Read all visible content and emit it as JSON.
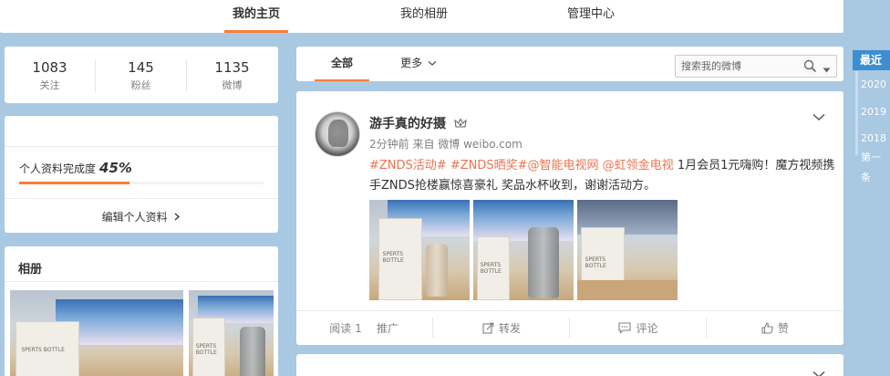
{
  "topnav": {
    "tabs": [
      "我的主页",
      "我的相册",
      "管理中心"
    ]
  },
  "stats": [
    {
      "num": "1083",
      "label": "关注"
    },
    {
      "num": "145",
      "label": "粉丝"
    },
    {
      "num": "1135",
      "label": "微博"
    }
  ],
  "profile": {
    "completion_label": "个人资料完成度",
    "completion_value": "45%",
    "completion_fraction": 0.45,
    "edit_label": "编辑个人资料"
  },
  "album": {
    "title": "相册"
  },
  "feed": {
    "tabs": [
      "全部",
      "更多"
    ],
    "search_placeholder": "搜索我的微博"
  },
  "post": {
    "author": "游手真的好摄",
    "meta": "2分钟前 来自 微博 weibo.com",
    "tag1": "#ZNDS活动#",
    "tag2": "#ZNDS晒奖#",
    "tag3": "@智能电视网",
    "tag4": "@虹领金电视",
    "text_rest": " 1月会员1元嗨购！魔方视频携手ZNDS抢楼赢惊喜豪礼 奖品水杯收到，谢谢活动方。",
    "actions": [
      "阅读 1",
      "推广",
      "转发",
      "评论",
      "赞"
    ]
  },
  "timeline": {
    "head": "最近",
    "years": [
      "2020",
      "2019",
      "2018"
    ],
    "more": "第一条"
  },
  "colors": {
    "accent": "#fa7d3c",
    "link": "#eb7350",
    "timeline": "#3d8ed0"
  }
}
